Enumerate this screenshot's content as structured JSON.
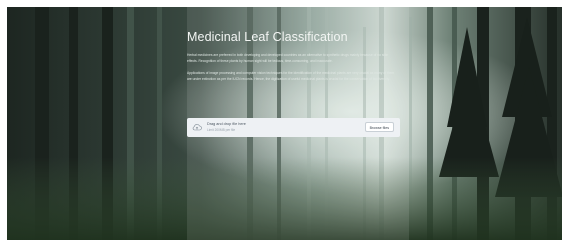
{
  "app": {
    "title": "Medicinal Leaf Classification"
  },
  "intro": {
    "paragraph_1": "Herbal medicines are preferred in both developing and developed countries as an alternative to synthetic drugs mainly because of no side effects. Recognition of these plants by human sight will be tedious, time-consuming, and inaccurate.",
    "paragraph_2": "Applications of image processing and computer vision techniques for the identification of the medicinal plants are very crucial as many of them are under extinction as per the IUCN records. Hence, the digitization of useful medicinal plants is crucial for the conservation of biodiversity."
  },
  "uploader": {
    "label": "Drag and drop file here",
    "limit": "Limit 200MB per file",
    "browse_label": "Browse files",
    "icon": "cloud-upload-icon"
  },
  "colors": {
    "upload_bg": "#eef1f4",
    "title_text": "#f3f6f4"
  }
}
